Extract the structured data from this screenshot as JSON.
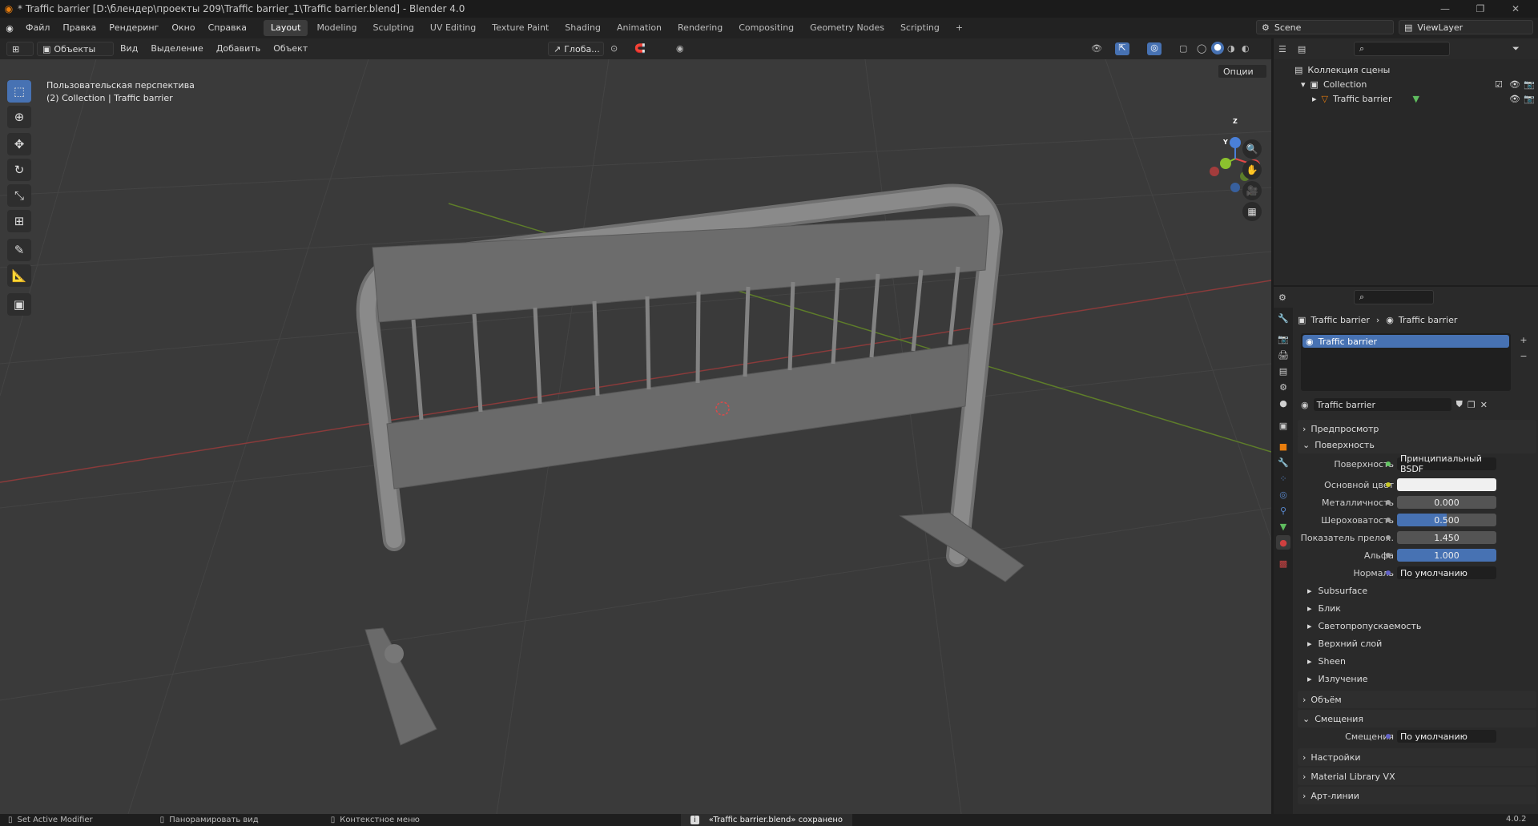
{
  "title_bar": {
    "text": "* Traffic barrier [D:\\блендер\\проекты 209\\Traffic barrier_1\\Traffic barrier.blend] - Blender 4.0"
  },
  "menu": [
    "Файл",
    "Правка",
    "Рендеринг",
    "Окно",
    "Справка"
  ],
  "workspaces": [
    "Layout",
    "Modeling",
    "Sculpting",
    "UV Editing",
    "Texture Paint",
    "Shading",
    "Animation",
    "Rendering",
    "Compositing",
    "Geometry Nodes",
    "Scripting"
  ],
  "active_workspace": "Layout",
  "add_workspace": "+",
  "scene": {
    "label": "Scene",
    "view_layer": "ViewLayer"
  },
  "viewport_header": {
    "mode": "Объекты",
    "menus": [
      "Вид",
      "Выделение",
      "Добавить",
      "Объект"
    ],
    "transform_orientation": "Глоба...",
    "options": "Опции"
  },
  "viewport": {
    "perspective_label": "Пользовательская перспектива",
    "collection_label": "(2) Collection | Traffic barrier",
    "gizmo": {
      "x": "X",
      "y": "Y",
      "z": "Z"
    }
  },
  "tools": [
    "select-box",
    "cursor",
    "move",
    "rotate",
    "scale",
    "transform",
    "annotate",
    "measure",
    "add-cube"
  ],
  "outliner": {
    "scene_collection": "Коллекция сцены",
    "collection": "Collection",
    "object": "Traffic barrier"
  },
  "properties": {
    "breadcrumb_object": "Traffic barrier",
    "breadcrumb_material": "Traffic barrier",
    "material_slot": "Traffic barrier",
    "material_name": "Traffic barrier",
    "sections": {
      "preview": "Предпросмотр",
      "surface": "Поверхность",
      "volume": "Объём",
      "displacement": "Смещения",
      "settings": "Настройки",
      "material_library": "Material Library VX",
      "lineart": "Арт-линии"
    },
    "surface_fields": [
      {
        "label": "Поверхность",
        "value": "Принципиальный BSDF",
        "kind": "dark",
        "dot": "#63c763"
      },
      {
        "label": "Основной цвет",
        "value": "",
        "kind": "color",
        "dot": "#c7c729"
      },
      {
        "label": "Металличность",
        "value": "0.000",
        "kind": "num",
        "dot": "#a1a1a1"
      },
      {
        "label": "Шероховатость",
        "value": "0.500",
        "kind": "blue",
        "dot": "#a1a1a1",
        "fill": 0.5
      },
      {
        "label": "Показатель прело...",
        "value": "1.450",
        "kind": "num",
        "dot": "#a1a1a1"
      },
      {
        "label": "Альфа",
        "value": "1.000",
        "kind": "blue",
        "dot": "#a1a1a1",
        "fill": 1.0
      },
      {
        "label": "Нормаль",
        "value": "По умолчанию",
        "kind": "dark",
        "dot": "#6363c7"
      }
    ],
    "subpanels": [
      "Subsurface",
      "Блик",
      "Светопропускаемость",
      "Верхний слой",
      "Sheen",
      "Излучение"
    ],
    "displacement_field": {
      "label": "Смещения",
      "value": "По умолчанию"
    }
  },
  "status_bar": {
    "left": "Set Active Modifier",
    "middle": "Панорамировать вид",
    "context": "Контекстное меню",
    "message": "«Traffic barrier.blend» сохранено",
    "version": "4.0.2"
  },
  "colors": {
    "accent": "#4772b3",
    "orange": "#e87d0d",
    "x_axis": "#e54848",
    "y_axis": "#8bc12e",
    "z_axis": "#4a80d8"
  }
}
